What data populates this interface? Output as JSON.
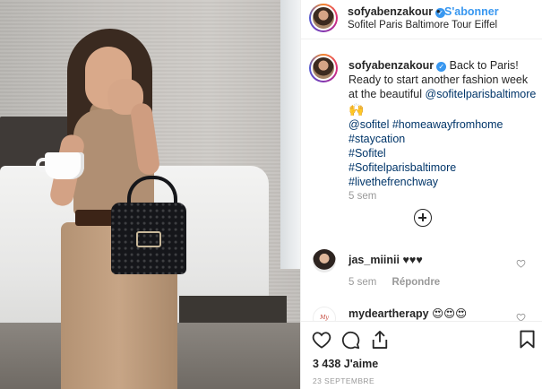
{
  "header": {
    "username": "sofyabenzakour",
    "separator": "•",
    "follow_label": "S'abonner",
    "location": "Sofitel Paris Baltimore Tour Eiffel"
  },
  "caption": {
    "username": "sofyabenzakour",
    "text": "Back to Paris! Ready to start another fashion week at the beautiful",
    "mention": "@sofitelparisbaltimore",
    "emoji": "🙌",
    "hashtags": [
      "@sofitel #homeawayfromhome",
      "#staycation",
      "#Sofitel",
      "#Sofitelparisbaltimore",
      "#livethefrenchway"
    ],
    "time": "5 sem"
  },
  "comments": [
    {
      "username": "jas_miinii",
      "text": "♥♥♥",
      "time": "5 sem",
      "reply_label": "Répondre"
    },
    {
      "username": "mydeartherapy",
      "text": "😍😍😍",
      "avatar_text": "My Dear"
    }
  ],
  "footer": {
    "likes": "3 438 J'aime",
    "date": "23 SEPTEMBRE"
  },
  "icons": {
    "like": "heart-icon",
    "comment": "comment-icon",
    "share": "share-icon",
    "save": "bookmark-icon",
    "load_more": "plus-circle-icon"
  },
  "colors": {
    "link": "#3897f0",
    "hashtag": "#003569",
    "muted": "#999999"
  }
}
